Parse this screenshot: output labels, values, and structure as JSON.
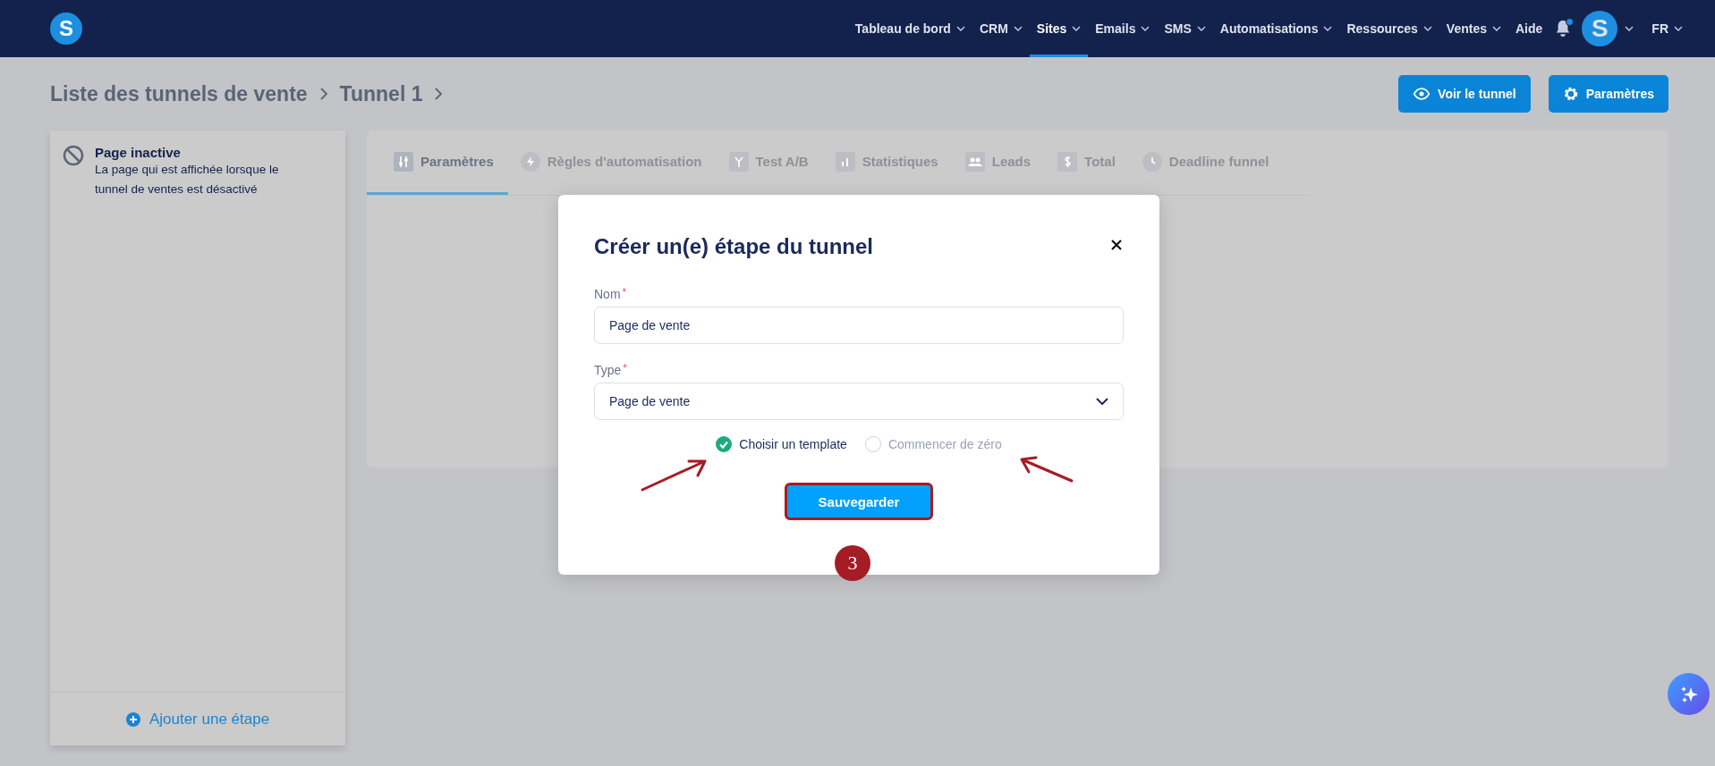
{
  "nav": {
    "logo_letter": "S",
    "items": [
      {
        "label": "Tableau de bord",
        "dropdown": true,
        "selected": false
      },
      {
        "label": "CRM",
        "dropdown": true,
        "selected": false
      },
      {
        "label": "Sites",
        "dropdown": true,
        "selected": true
      },
      {
        "label": "Emails",
        "dropdown": true,
        "selected": false
      },
      {
        "label": "SMS",
        "dropdown": true,
        "selected": false
      },
      {
        "label": "Automatisations",
        "dropdown": true,
        "selected": false
      },
      {
        "label": "Ressources",
        "dropdown": true,
        "selected": false
      },
      {
        "label": "Ventes",
        "dropdown": true,
        "selected": false
      },
      {
        "label": "Aide",
        "dropdown": false,
        "selected": false
      }
    ],
    "notification_unread": true,
    "avatar_letter": "S",
    "language": "FR"
  },
  "breadcrumbs": [
    "Liste des tunnels de vente",
    "Tunnel 1"
  ],
  "header_buttons": [
    "Voir le tunnel",
    "Paramètres"
  ],
  "sidebar": {
    "items": [
      {
        "title": "Page inactive",
        "description": "La page qui est affichée lorsque le tunnel de ventes est désactivé"
      }
    ],
    "add_button": "Ajouter une étape"
  },
  "tabs": [
    {
      "label": "Paramètres",
      "selected": true
    },
    {
      "label": "Règles d'automatisation",
      "selected": false
    },
    {
      "label": "Test A/B",
      "selected": false
    },
    {
      "label": "Statistiques",
      "selected": false
    },
    {
      "label": "Leads",
      "selected": false
    },
    {
      "label": "Total",
      "selected": false
    },
    {
      "label": "Deadline funnel",
      "selected": false
    }
  ],
  "modal": {
    "title": "Créer un(e) étape du tunnel",
    "fields": [
      {
        "kind": "text",
        "label": "Nom",
        "required_mark": "*",
        "value": "Page de vente"
      },
      {
        "kind": "select",
        "label": "Type",
        "required_mark": "*",
        "value": "Page de vente"
      }
    ],
    "options": [
      {
        "label": "Choisir un template",
        "selected": true
      },
      {
        "label": "Commencer de zéro",
        "selected": false
      }
    ],
    "save_button": "Sauvegarder"
  },
  "annotation": {
    "step_number": "3"
  }
}
